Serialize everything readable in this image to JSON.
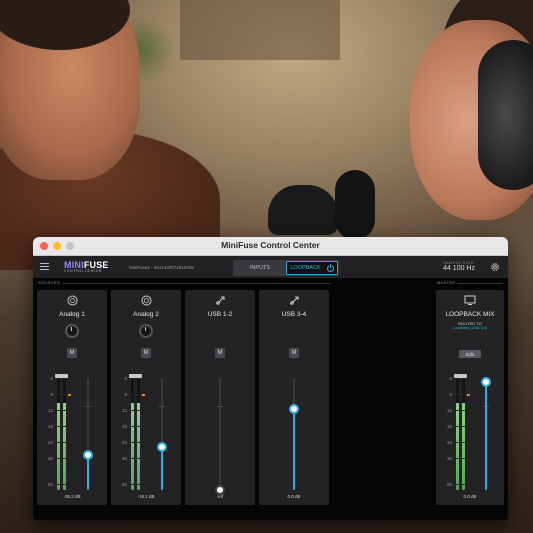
{
  "window": {
    "title": "MiniFuse Control Center"
  },
  "brand": {
    "main_a": "MINI",
    "main_b": "FUSE",
    "sub": "CONTROL CENTER"
  },
  "device": {
    "label": "MiniFuse2 - 8441400673010035"
  },
  "tabs": [
    {
      "label": "INPUTS"
    },
    {
      "label": "LOOPBACK"
    }
  ],
  "samplerate": {
    "label": "SAMPLE RATE",
    "value": "44 100 Hz"
  },
  "sections": {
    "sources": "SOURCES",
    "master": "MASTER"
  },
  "scale_labels": [
    "0",
    "6",
    "12",
    "18",
    "24",
    "30",
    "60"
  ],
  "strips": [
    {
      "name": "Analog 1",
      "icon": "mic-icon",
      "mute": "M",
      "db": "-26.2 dB",
      "fader_level": 0.31,
      "meter_level": 0.78
    },
    {
      "name": "Analog 2",
      "icon": "mic-icon",
      "mute": "M",
      "db": "-19.1 dB",
      "fader_level": 0.38,
      "meter_level": 0.78
    },
    {
      "name": "USB 1-2",
      "icon": "usb-icon",
      "mute": "M",
      "db": "-inf",
      "fader_level": 0.0,
      "meter_level": 0
    },
    {
      "name": "USB 3-4",
      "icon": "usb-icon",
      "mute": "M",
      "db": "0.0 dB",
      "fader_level": 0.72,
      "meter_level": 0
    }
  ],
  "master": {
    "name": "LOOPBACK MIX",
    "routed_label": "ROUTED TO",
    "routed_to": "Loopback (USB 5-6)",
    "edit": "Edit",
    "db": "0.0 dB",
    "fader_level": 0.96,
    "meter_level": 0.78,
    "icon": "monitor-icon"
  },
  "colors": {
    "accent": "#2fb0e2",
    "meter": "#8fd38a"
  }
}
